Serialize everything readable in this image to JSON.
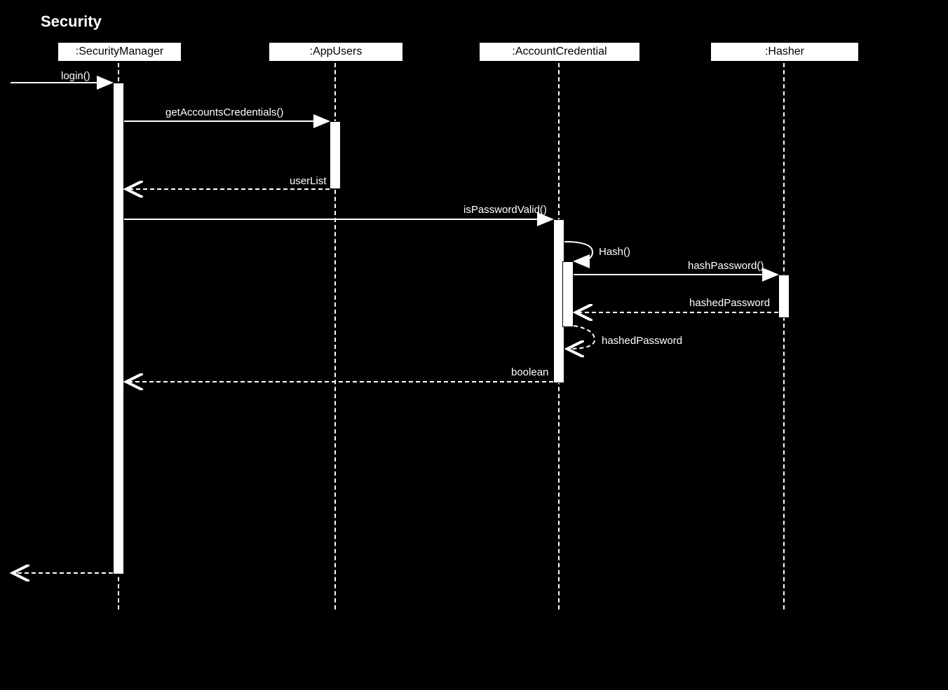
{
  "title": "Security",
  "participants": [
    {
      "name": ":SecurityManager"
    },
    {
      "name": ":AppUsers"
    },
    {
      "name": ":AccountCredential"
    },
    {
      "name": ":Hasher"
    }
  ],
  "messages": {
    "login": "login()",
    "getAccountsCredentials": "getAccountsCredentials()",
    "userList": "userList",
    "isPasswordValid": "isPasswordValid()",
    "hash": "Hash()",
    "hashPassword": "hashPassword()",
    "hashedPassword": "hashedPassword",
    "hashedPasswordReturn": "hashedPassword",
    "boolean": "boolean"
  }
}
